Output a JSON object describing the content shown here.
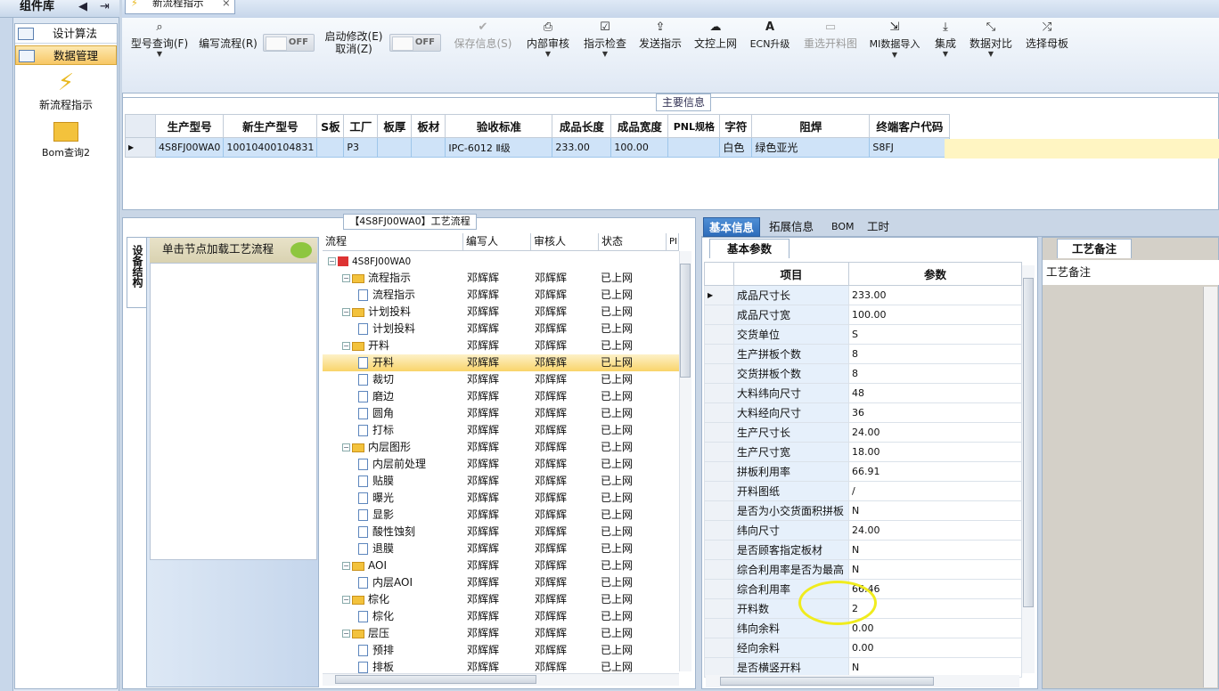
{
  "left_panel": {
    "title": "组件库",
    "items": [
      "设计算法",
      "数据管理"
    ],
    "tools": [
      "新流程指示",
      "Bom查询2"
    ]
  },
  "document_tab": {
    "label": "新流程指示",
    "close": "×"
  },
  "toolbar": {
    "buttons": [
      {
        "label": "型号查询(F)",
        "icon": "search-icon",
        "dropdown": true
      },
      {
        "label": "编写流程(R)",
        "icon": "none",
        "dropdown": false
      },
      {
        "label": "启动修改(E)\n取消(Z)",
        "icon": "none",
        "dropdown": false
      },
      {
        "label": "保存信息(S)",
        "icon": "check-icon",
        "dropdown": false,
        "disabled": true
      },
      {
        "label": "内部审核",
        "icon": "print-icon",
        "dropdown": true
      },
      {
        "label": "指示检查",
        "icon": "checkbox-icon",
        "dropdown": true
      },
      {
        "label": "发送指示",
        "icon": "upload-icon",
        "dropdown": false
      },
      {
        "label": "文控上网",
        "icon": "cloud-upload-icon",
        "dropdown": false
      },
      {
        "label": "ECN升级",
        "icon": "font-icon",
        "dropdown": false
      },
      {
        "label": "重选开料图",
        "icon": "image-icon",
        "dropdown": false,
        "disabled": true
      },
      {
        "label": "MI数据导入",
        "icon": "import-icon",
        "dropdown": true
      },
      {
        "label": "集成",
        "icon": "download-icon",
        "dropdown": true
      },
      {
        "label": "数据对比",
        "icon": "compress-icon",
        "dropdown": true
      },
      {
        "label": "选择母板",
        "icon": "shuffle-icon",
        "dropdown": false
      }
    ],
    "toggle_off": "OFF"
  },
  "main_info": {
    "label": "主要信息",
    "columns": [
      "生产型号",
      "新生产型号",
      "S板",
      "工厂",
      "板厚",
      "板材",
      "验收标准",
      "成品长度",
      "成品宽度",
      "PNL规格",
      "字符",
      "阻焊",
      "终端客户代码"
    ],
    "row": [
      "4S8FJ00WA0",
      "10010400104831",
      "",
      "P3",
      "",
      "",
      "IPC-6012 Ⅱ级",
      "233.00",
      "100.00",
      "",
      "白色",
      "绿色亚光",
      "S8FJ"
    ]
  },
  "flow": {
    "title": "【4S8FJ00WA0】工艺流程",
    "vertical_tab": "设备结构",
    "device_hint": "单击节点加载工艺流程",
    "columns": [
      "流程",
      "编写人",
      "审核人",
      "状态",
      "PI"
    ],
    "root": "4S8FJ00WA0",
    "rows": [
      {
        "name": "流程指示",
        "level": 1,
        "type": "folder",
        "writer": "邓辉辉",
        "reviewer": "邓辉辉",
        "status": "已上网"
      },
      {
        "name": "流程指示",
        "level": 2,
        "type": "doc",
        "writer": "邓辉辉",
        "reviewer": "邓辉辉",
        "status": "已上网"
      },
      {
        "name": "计划投料",
        "level": 1,
        "type": "folder",
        "writer": "邓辉辉",
        "reviewer": "邓辉辉",
        "status": "已上网"
      },
      {
        "name": "计划投料",
        "level": 2,
        "type": "doc",
        "writer": "邓辉辉",
        "reviewer": "邓辉辉",
        "status": "已上网"
      },
      {
        "name": "开料",
        "level": 1,
        "type": "folder",
        "writer": "邓辉辉",
        "reviewer": "邓辉辉",
        "status": "已上网"
      },
      {
        "name": "开料",
        "level": 2,
        "type": "doc",
        "writer": "邓辉辉",
        "reviewer": "邓辉辉",
        "status": "已上网",
        "selected": true
      },
      {
        "name": "裁切",
        "level": 2,
        "type": "doc",
        "writer": "邓辉辉",
        "reviewer": "邓辉辉",
        "status": "已上网"
      },
      {
        "name": "磨边",
        "level": 2,
        "type": "doc",
        "writer": "邓辉辉",
        "reviewer": "邓辉辉",
        "status": "已上网"
      },
      {
        "name": "圆角",
        "level": 2,
        "type": "doc",
        "writer": "邓辉辉",
        "reviewer": "邓辉辉",
        "status": "已上网"
      },
      {
        "name": "打标",
        "level": 2,
        "type": "doc",
        "writer": "邓辉辉",
        "reviewer": "邓辉辉",
        "status": "已上网"
      },
      {
        "name": "内层图形",
        "level": 1,
        "type": "folder",
        "writer": "邓辉辉",
        "reviewer": "邓辉辉",
        "status": "已上网"
      },
      {
        "name": "内层前处理",
        "level": 2,
        "type": "doc",
        "writer": "邓辉辉",
        "reviewer": "邓辉辉",
        "status": "已上网"
      },
      {
        "name": "贴膜",
        "level": 2,
        "type": "doc",
        "writer": "邓辉辉",
        "reviewer": "邓辉辉",
        "status": "已上网"
      },
      {
        "name": "曝光",
        "level": 2,
        "type": "doc",
        "writer": "邓辉辉",
        "reviewer": "邓辉辉",
        "status": "已上网"
      },
      {
        "name": "显影",
        "level": 2,
        "type": "doc",
        "writer": "邓辉辉",
        "reviewer": "邓辉辉",
        "status": "已上网"
      },
      {
        "name": "酸性蚀刻",
        "level": 2,
        "type": "doc",
        "writer": "邓辉辉",
        "reviewer": "邓辉辉",
        "status": "已上网"
      },
      {
        "name": "退膜",
        "level": 2,
        "type": "doc",
        "writer": "邓辉辉",
        "reviewer": "邓辉辉",
        "status": "已上网"
      },
      {
        "name": "AOI",
        "level": 1,
        "type": "folder",
        "writer": "邓辉辉",
        "reviewer": "邓辉辉",
        "status": "已上网"
      },
      {
        "name": "内层AOI",
        "level": 2,
        "type": "doc",
        "writer": "邓辉辉",
        "reviewer": "邓辉辉",
        "status": "已上网"
      },
      {
        "name": "棕化",
        "level": 1,
        "type": "folder",
        "writer": "邓辉辉",
        "reviewer": "邓辉辉",
        "status": "已上网"
      },
      {
        "name": "棕化",
        "level": 2,
        "type": "doc",
        "writer": "邓辉辉",
        "reviewer": "邓辉辉",
        "status": "已上网"
      },
      {
        "name": "层压",
        "level": 1,
        "type": "folder",
        "writer": "邓辉辉",
        "reviewer": "邓辉辉",
        "status": "已上网"
      },
      {
        "name": "预排",
        "level": 2,
        "type": "doc",
        "writer": "邓辉辉",
        "reviewer": "邓辉辉",
        "status": "已上网"
      },
      {
        "name": "排板",
        "level": 2,
        "type": "doc",
        "writer": "邓辉辉",
        "reviewer": "邓辉辉",
        "status": "已上网"
      }
    ]
  },
  "right": {
    "tabs": [
      "基本信息",
      "拓展信息",
      "BOM",
      "工时"
    ],
    "basic_tab": "基本参数",
    "columns": [
      "项目",
      "参数"
    ],
    "params": [
      [
        "成品尺寸长",
        "233.00"
      ],
      [
        "成品尺寸宽",
        "100.00"
      ],
      [
        "交货单位",
        "S"
      ],
      [
        "生产拼板个数",
        "8"
      ],
      [
        "交货拼板个数",
        "8"
      ],
      [
        "大料纬向尺寸",
        "48"
      ],
      [
        "大料经向尺寸",
        "36"
      ],
      [
        "生产尺寸长",
        "24.00"
      ],
      [
        "生产尺寸宽",
        "18.00"
      ],
      [
        "拼板利用率",
        "66.91"
      ],
      [
        "开料图纸",
        "/"
      ],
      [
        "是否为小交货面积拼板",
        "N"
      ],
      [
        "纬向尺寸",
        "24.00"
      ],
      [
        "是否顾客指定板材",
        "N"
      ],
      [
        "综合利用率是否为最高",
        "N"
      ],
      [
        "综合利用率",
        "66.46"
      ],
      [
        "开料数",
        "2"
      ],
      [
        "纬向余料",
        "0.00"
      ],
      [
        "经向余料",
        "0.00"
      ],
      [
        "是否横竖开料",
        "N"
      ]
    ],
    "craft_tab": "工艺备注",
    "craft_label": "工艺备注"
  }
}
